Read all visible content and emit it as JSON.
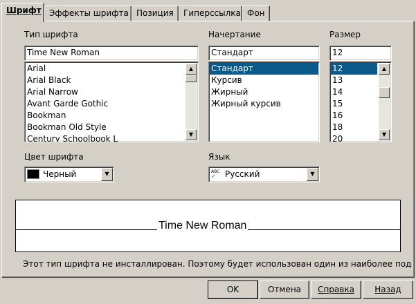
{
  "tabs": [
    {
      "label": "Шрифт",
      "active": true
    },
    {
      "label": "Эффекты шрифта",
      "active": false
    },
    {
      "label": "Позиция",
      "active": false
    },
    {
      "label": "Гиперссылка",
      "active": false
    },
    {
      "label": "Фон",
      "active": false
    }
  ],
  "font_family": {
    "label": "Тип шрифта",
    "value": "Time New Roman",
    "items": [
      "Arial",
      "Arial Black",
      "Arial Narrow",
      "Avant Garde Gothic",
      "Bookman",
      "Bookman Old Style",
      "Century Schoolbook L"
    ]
  },
  "typeface": {
    "label": "Начертание",
    "value": "Стандарт",
    "items": [
      "Стандарт",
      "Курсив",
      "Жирный",
      "Жирный курсив"
    ],
    "selected_index": 0
  },
  "size": {
    "label": "Размер",
    "value": "12",
    "items": [
      "12",
      "13",
      "14",
      "15",
      "16",
      "18",
      "20"
    ],
    "selected_index": 0
  },
  "font_color": {
    "label": "Цвет шрифта",
    "value": "Черный",
    "swatch": "#000000"
  },
  "language": {
    "label": "Язык",
    "value": "Русский",
    "icon_text": "ABC"
  },
  "preview": {
    "text": "Time New Roman"
  },
  "info_text": "Этот тип шрифта не инсталлирован. Поэтому будет использован один из наиболее подходящ",
  "buttons": {
    "ok": "OK",
    "cancel": "Отмена",
    "help": "Справка",
    "back": "Назад"
  },
  "colors": {
    "selection": "#0a5a8c",
    "dialog_bg": "#d4d0c8"
  }
}
